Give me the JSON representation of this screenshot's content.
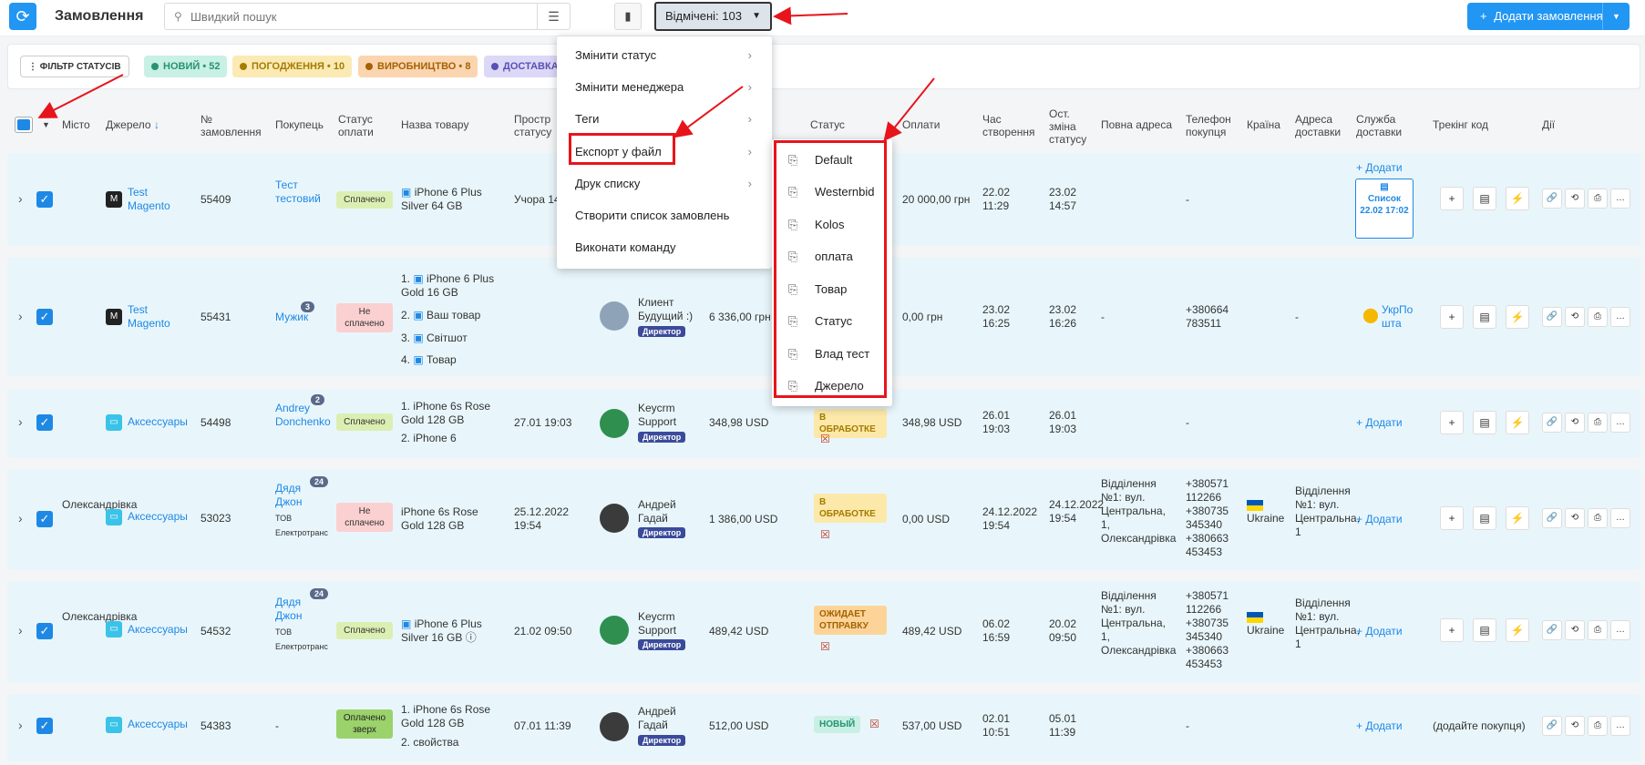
{
  "header": {
    "title": "Замовлення",
    "search_placeholder": "Швидкий пошук",
    "selected_label": "Відмічені: 103",
    "add_order_label": "Додати замовлення"
  },
  "status_filters": {
    "filter_label": "ФІЛЬТР СТАТУСІВ",
    "chips": [
      {
        "label": "НОВИЙ",
        "count": "52",
        "color": "#c8f0e4",
        "text": "#27946d",
        "dot": "#27946d"
      },
      {
        "label": "ПОГОДЖЕННЯ",
        "count": "10",
        "color": "#fbeab4",
        "text": "#a57b00",
        "dot": "#a57b00"
      },
      {
        "label": "ВИРОБНИЦТВО",
        "count": "8",
        "color": "#fbd5b0",
        "text": "#a56200",
        "dot": "#a56200"
      },
      {
        "label": "ДОСТАВКА",
        "count": "",
        "color": "#dcd8f7",
        "text": "#5a4fb5",
        "dot": "#5a4fb5"
      }
    ]
  },
  "columns": {
    "city": "Місто",
    "source": "Джерело",
    "order_no": "№ замовлення",
    "buyer": "Покупець",
    "pay_status": "Статус оплати",
    "product": "Назва товару",
    "overdue": "Простр статусу",
    "status": "Статус",
    "payments": "Оплати",
    "created": "Час створення",
    "changed": "Ост. зміна статусу",
    "address": "Повна адреса",
    "phone": "Телефон покупця",
    "country": "Країна",
    "delivery_address": "Адреса доставки",
    "delivery_service": "Служба доставки",
    "tracking": "Трекінг код",
    "actions": "Дії"
  },
  "context_menu": {
    "items": [
      {
        "label": "Змінити статус",
        "has_sub": true
      },
      {
        "label": "Змінити менеджера",
        "has_sub": true
      },
      {
        "label": "Теги",
        "has_sub": true
      },
      {
        "label": "Експорт у файл",
        "has_sub": true
      },
      {
        "label": "Друк списку",
        "has_sub": true
      },
      {
        "label": "Створити список замовлень",
        "has_sub": false
      },
      {
        "label": "Виконати команду",
        "has_sub": false
      }
    ],
    "export_items": [
      "Default",
      "Westernbid",
      "Kolos",
      "оплата",
      "Товар",
      "Статус",
      "Влад тест",
      "Джерело"
    ]
  },
  "rows": [
    {
      "city": "",
      "source": "Test Magento",
      "order_no": "55409",
      "buyer": "Тест тестовий",
      "buyer_badge": "",
      "pay": "Сплачено",
      "product": "iPhone 6 Plus Silver 64 GB",
      "overdue": "Учора 14",
      "created": "22.02 11:29",
      "changed": "23.02 14:57",
      "payments": "20 000,00 грн",
      "phone": "-",
      "delivery_add": "Додати",
      "list_label": "Список",
      "list_date": "22.02 17:02"
    },
    {
      "city": "",
      "source": "Test Magento",
      "order_no": "55431",
      "buyer": "Мужик",
      "buyer_badge": "3",
      "pay": "Не сплачено",
      "products": [
        "iPhone 6 Plus Gold 16 GB",
        "Ваш товар",
        "Світшот",
        "Товар"
      ],
      "manager": "Клиент Будущий :)",
      "role": "Директор",
      "amount": "6 336,00 грн",
      "payments": "0,00 грн",
      "created": "23.02 16:25",
      "changed": "23.02 16:26",
      "address": "-",
      "phone": "+380664 783511",
      "delivery_address": "-",
      "delivery_service": "УкрПо шта"
    },
    {
      "city": "",
      "source": "Аксессуары",
      "order_no": "54498",
      "buyer": "Andrey Donchenko",
      "buyer_badge": "2",
      "pay": "Сплачено",
      "products": [
        "iPhone 6s Rose Gold 128 GB",
        "iPhone 6"
      ],
      "overdue": "27.01 19:03",
      "manager": "Keycrm Support",
      "role": "Директор",
      "amount": "348,98 USD",
      "status": "В ОБРАБОТКЕ",
      "payments": "348,98 USD",
      "created": "26.01 19:03",
      "changed": "26.01 19:03",
      "phone": "-",
      "delivery_add": "Додати"
    },
    {
      "city": "Олександрівка",
      "source": "Аксессуары",
      "order_no": "53023",
      "buyer": "Дядя Джон",
      "buyer_company": "ТОВ Електротранс",
      "buyer_badge": "24",
      "pay": "Не сплачено",
      "product": "iPhone 6s Rose Gold 128 GB",
      "overdue": "25.12.2022 19:54",
      "manager": "Андрей Гадай",
      "role": "Директор",
      "amount": "1 386,00 USD",
      "status": "В ОБРАБОТКЕ",
      "payments": "0,00 USD",
      "created": "24.12.2022 19:54",
      "changed": "24.12.2022 19:54",
      "address": "Відділення №1: вул. Центральна, 1, Олександрівка",
      "phone": "+380571 112266 +380735 345340 +380663 453453",
      "country": "Ukraine",
      "delivery_address": "Відділення №1: вул. Центральна, 1",
      "delivery_add": "Додати"
    },
    {
      "city": "Олександрівка",
      "source": "Аксессуары",
      "order_no": "54532",
      "buyer": "Дядя Джон",
      "buyer_company": "ТОВ Електротранс",
      "buyer_badge": "24",
      "pay": "Сплачено",
      "product": "iPhone 6 Plus Silver 16 GB",
      "overdue": "21.02 09:50",
      "manager": "Keycrm Support",
      "role": "Директор",
      "amount": "489,42 USD",
      "status": "ОЖИДАЕТ ОТПРАВКУ",
      "payments": "489,42 USD",
      "created": "06.02 16:59",
      "changed": "20.02 09:50",
      "address": "Відділення №1: вул. Центральна, 1, Олександрівка",
      "phone": "+380571 112266 +380735 345340 +380663 453453",
      "country": "Ukraine",
      "delivery_address": "Відділення №1: вул. Центральна, 1",
      "delivery_add": "Додати"
    },
    {
      "city": "",
      "source": "Аксессуары",
      "order_no": "54383",
      "buyer": "-",
      "pay": "Оплачено зверх",
      "products": [
        "iPhone 6s Rose Gold 128 GB",
        "свойства"
      ],
      "overdue": "07.01 11:39",
      "manager": "Андрей Гадай",
      "role": "Директор",
      "amount": "512,00 USD",
      "status": "НОВЫЙ",
      "payments": "537,00 USD",
      "created": "02.01 10:51",
      "changed": "05.01 11:39",
      "phone": "-",
      "delivery_add": "Додати",
      "tracking": "(додайте покупця)"
    }
  ]
}
